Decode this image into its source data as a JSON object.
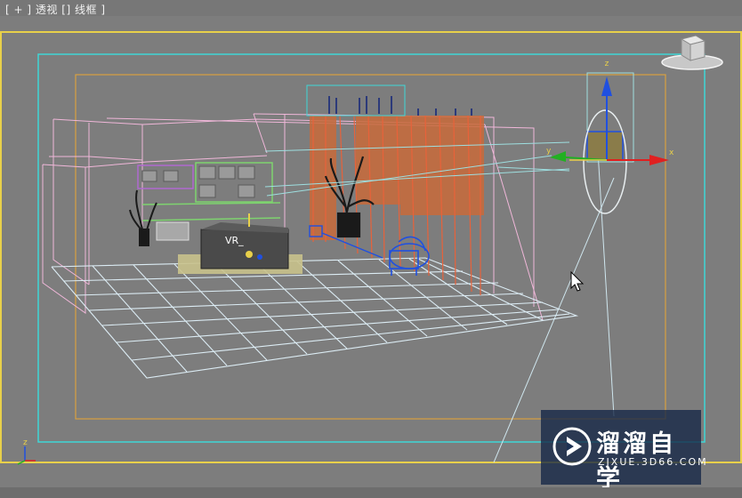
{
  "viewport": {
    "label_parts": [
      "[",
      "+",
      "]",
      "透视",
      "[]",
      "线框",
      "]"
    ],
    "view_name": "透视",
    "shading_mode": "线框"
  },
  "gizmo": {
    "axis_z": "z",
    "axis_x": "x",
    "axis_y": "y",
    "corner_axis_z": "z"
  },
  "colors": {
    "viewport_bg": "#7d7d7d",
    "active_frame": "#e8d04a",
    "safe_frame": "#3fd6d6",
    "grid": "#dcecf4",
    "room_wireframe": "#f0b7d9",
    "curtain": "#e8623a",
    "shelf_frame": "#7ed36f"
  },
  "scene": {
    "object_label": "VR_"
  },
  "watermark": {
    "title": "溜溜自学",
    "url": "ZIXUE.3D66.COM"
  }
}
